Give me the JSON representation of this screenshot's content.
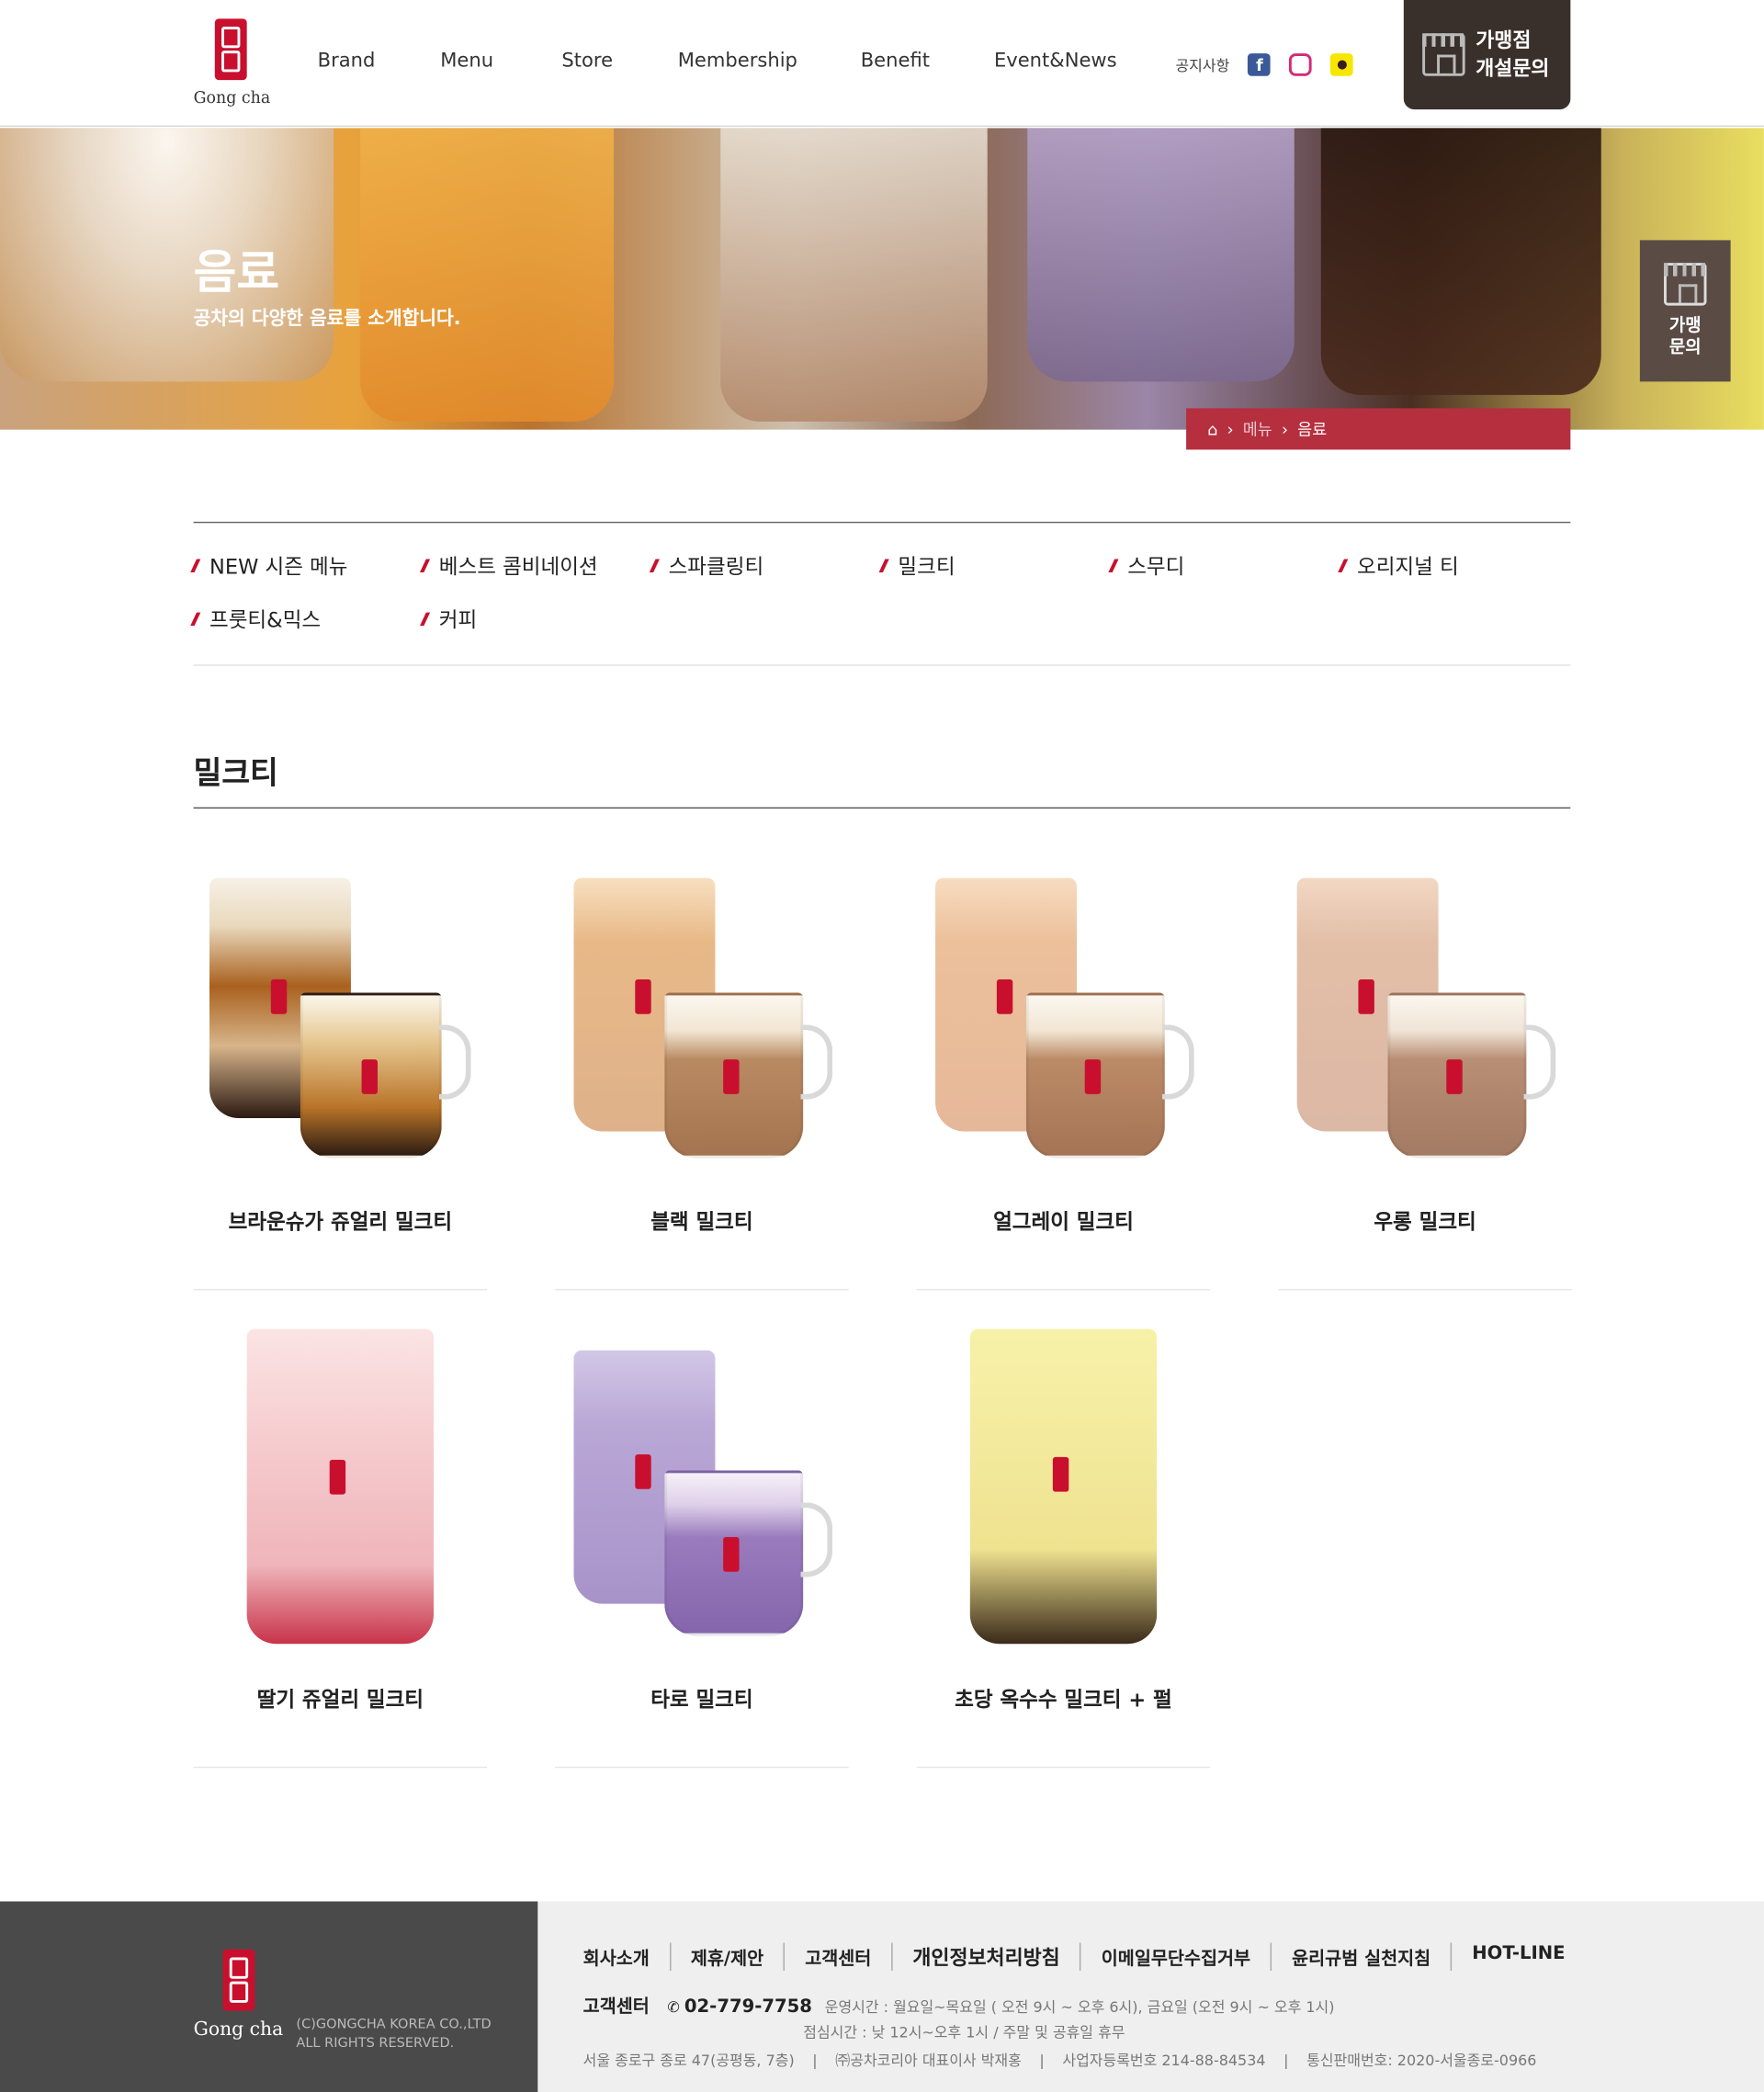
{
  "header": {
    "logo_text": "Gong cha",
    "nav": [
      "Brand",
      "Menu",
      "Store",
      "Membership",
      "Benefit",
      "Event&News"
    ],
    "notice": "공지사항",
    "sns": [
      "facebook-icon",
      "instagram-icon",
      "kakao-icon"
    ],
    "franchise_line1": "가맹점",
    "franchise_line2": "개설문의"
  },
  "hero": {
    "title": "음료",
    "subtitle": "공차의 다양한 음료를 소개합니다.",
    "breadcrumb": [
      "메뉴",
      "음료"
    ]
  },
  "side_button": {
    "line1": "가맹",
    "line2": "문의"
  },
  "categories": [
    "NEW 시즌 메뉴",
    "베스트 콤비네이션",
    "스파클링티",
    "밀크티",
    "스무디",
    "오리지널 티",
    "프룻티&믹스",
    "커피"
  ],
  "section_title": "밀크티",
  "products": [
    {
      "name": "브라운슈가 쥬얼리 밀크티"
    },
    {
      "name": "블랙 밀크티"
    },
    {
      "name": "얼그레이 밀크티"
    },
    {
      "name": "우롱 밀크티"
    },
    {
      "name": "딸기 쥬얼리 밀크티"
    },
    {
      "name": "타로 밀크티"
    },
    {
      "name": "초당 옥수수 밀크티 + 펄"
    }
  ],
  "footer": {
    "logo_text": "Gong cha",
    "copyright1": "(C)GONGCHA KOREA CO.,LTD",
    "copyright2": "ALL RIGHTS RESERVED.",
    "menu": [
      "회사소개",
      "제휴/제안",
      "고객센터",
      "개인정보처리방침",
      "이메일무단수집거부",
      "윤리규범 실천지침",
      "HOT-LINE"
    ],
    "cs_label": "고객센터",
    "phone": "02-779-7758",
    "hours1": "운영시간 : 월요일~목요일 ( 오전 9시 ~ 오후 6시), 금요일 (오전 9시 ~ 오후 1시)",
    "hours2": "점심시간 : 낮 12시~오후 1시 / 주말 및 공휴일 휴무",
    "address": "서울 종로구 종로 47(공평동, 7층)",
    "ceo": "㈜공차코리아 대표이사 박재홍",
    "biz_no": "사업자등록번호 214-88-84534",
    "mail_order": "통신판매번호: 2020-서울종로-0966"
  }
}
